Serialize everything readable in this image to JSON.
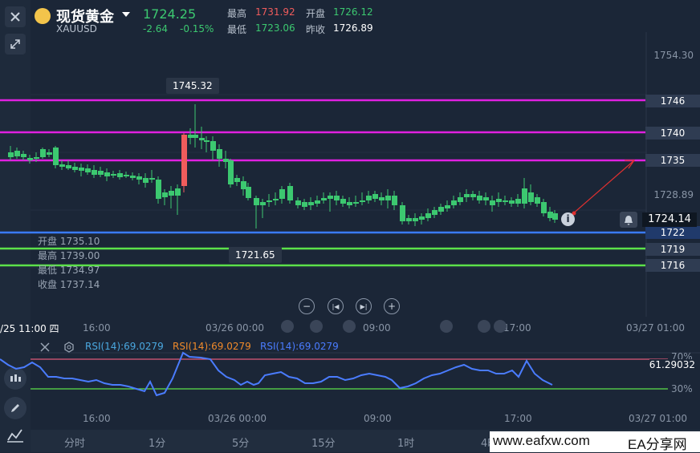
{
  "header": {
    "title": "现货黄金",
    "symbol": "XAUUSD",
    "price": "1724.25",
    "change": "-2.64",
    "change_pct": "-0.15%",
    "high_label": "最高",
    "high": "1731.92",
    "open_label": "开盘",
    "open": "1726.12",
    "low_label": "最低",
    "low": "1723.06",
    "prev_close_label": "昨收",
    "prev_close": "1726.89"
  },
  "price_axis": {
    "ticks": [
      "1754.30",
      "1728.89"
    ],
    "current": "1724.14",
    "levels": [
      {
        "label": "1746",
        "color": "#e020e0"
      },
      {
        "label": "1740",
        "color": "#e020e0"
      },
      {
        "label": "1735",
        "color": "#e020e0"
      },
      {
        "label": "1722",
        "color": "#3a7bff"
      },
      {
        "label": "1719",
        "color": "#5ce14a"
      },
      {
        "label": "1716",
        "color": "#5ce14a"
      }
    ]
  },
  "annotations": {
    "max_label": "1745.32",
    "min_label": "1721.65"
  },
  "ohlc": {
    "open": "开盘 1735.10",
    "high": "最高 1739.00",
    "low": "最低 1734.97",
    "close": "收盘 1737.14"
  },
  "time_axis": {
    "cursor": "/25 11:00 四",
    "labels": [
      "16:00",
      "03/26 00:00",
      "09:00",
      "17:00",
      "03/27 01:00"
    ]
  },
  "rsi": {
    "legend": [
      {
        "text": "RSI(14):69.0279",
        "color": "#4aa8e0"
      },
      {
        "text": "RSI(14):69.0279",
        "color": "#f08a2a"
      },
      {
        "text": "RSI(14):69.0279",
        "color": "#4a7cff"
      }
    ],
    "value": "61.29032",
    "upper": "70%",
    "lower": "30%"
  },
  "timeframes": [
    "分时",
    "1分",
    "5分",
    "15分",
    "1时",
    "4时"
  ],
  "watermark": "www.eafxw.com",
  "watermark2": "EA分享网",
  "colors": {
    "up": "#3cc870",
    "down": "#f05c5c",
    "bg": "#1b2637"
  }
}
